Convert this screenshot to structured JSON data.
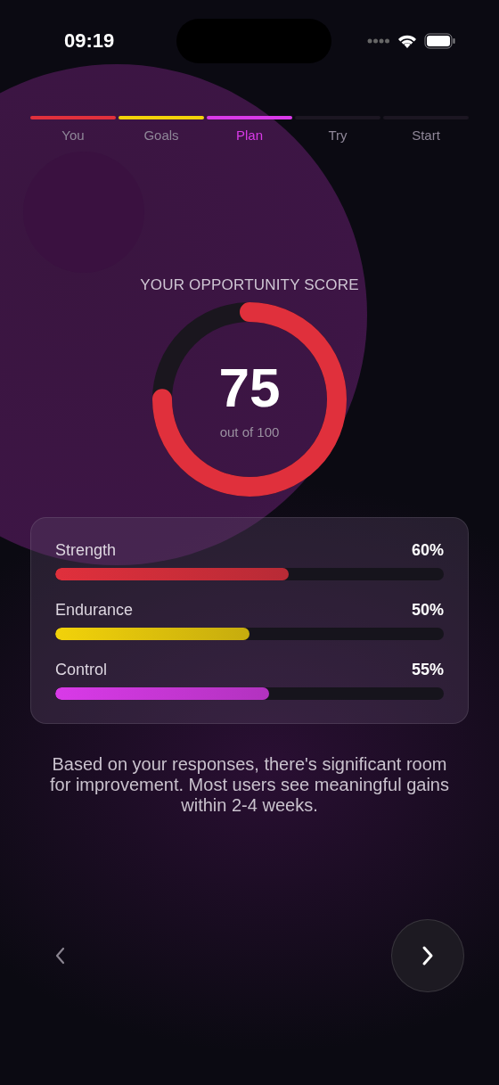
{
  "status_bar": {
    "time": "09:19"
  },
  "steps": [
    {
      "label": "You",
      "color": "#e0303c",
      "filled": true,
      "selected": false
    },
    {
      "label": "Goals",
      "color": "#f2d20a",
      "filled": true,
      "selected": false
    },
    {
      "label": "Plan",
      "color": "#d93ae8",
      "filled": true,
      "selected": true
    },
    {
      "label": "Try",
      "filled": false,
      "selected": false
    },
    {
      "label": "Start",
      "filled": false,
      "selected": false
    }
  ],
  "score": {
    "title": "YOUR OPPORTUNITY SCORE",
    "value": "75",
    "caption": "out of 100",
    "level": 0.75
  },
  "metrics": [
    {
      "name": "Strength",
      "reading": "60%",
      "level": 0.6,
      "color": "#e0303c"
    },
    {
      "name": "Endurance",
      "reading": "50%",
      "level": 0.5,
      "color": "#f2d20a"
    },
    {
      "name": "Control",
      "reading": "55%",
      "level": 0.55,
      "color": "#d93ae8"
    }
  ],
  "message": "Based on your responses, there's significant room for improvement. Most users see meaningful gains within 2-4 weeks."
}
